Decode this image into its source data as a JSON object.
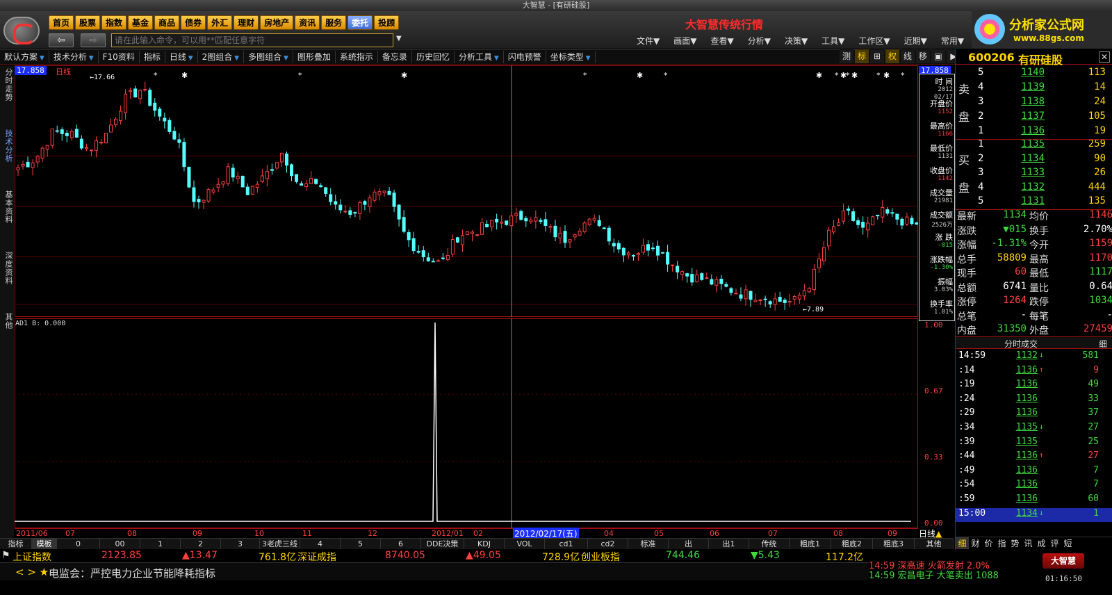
{
  "window": {
    "title": "大智慧 - [有研硅股]"
  },
  "nav_buttons": [
    "首页",
    "股票",
    "指数",
    "基金",
    "商品",
    "债券",
    "外汇",
    "理财",
    "房地产",
    "资讯",
    "服务",
    "委托",
    "投顾"
  ],
  "nav_active": 11,
  "command_input": {
    "placeholder": "请在此输入命令，可以用**匹配任意字符"
  },
  "headline": "大智慧传统行情",
  "top_menu": [
    "文件▼",
    "画面▼",
    "查看▼",
    "分析▼",
    "决策▼",
    "工具▼",
    "工作区▼",
    "近期▼",
    "常用▼"
  ],
  "brand": {
    "name": "分析家公式网",
    "url": "www.88gs.com"
  },
  "sub_toolbar": [
    {
      "label": "默认方案",
      "dd": true
    },
    {
      "label": "技术分析",
      "dd": true
    },
    {
      "label": "F10资料",
      "dd": false
    },
    {
      "label": "指标",
      "dd": false
    },
    {
      "label": "日线",
      "dd": true
    },
    {
      "label": "2图组合",
      "dd": true
    },
    {
      "label": "多图组合",
      "dd": true
    },
    {
      "label": "图形叠加",
      "dd": false
    },
    {
      "label": "系统指示",
      "dd": false
    },
    {
      "label": "备忘录",
      "dd": false
    },
    {
      "label": "历史回忆",
      "dd": false
    },
    {
      "label": "分析工具",
      "dd": true
    },
    {
      "label": "闪电预警",
      "dd": false
    },
    {
      "label": "坐标类型",
      "dd": true
    }
  ],
  "sub_tools": [
    "测",
    "标",
    "⊞",
    "权",
    "线",
    "移",
    "▣",
    "▶"
  ],
  "left_tabs": [
    "分时走势",
    "技术分析",
    "基本资料",
    "深度资料",
    "其他"
  ],
  "left_tab_active": 1,
  "chart": {
    "price_high_tag": "17.858",
    "period_label": "日线",
    "high_mark": "17.66",
    "low_mark": "7.89",
    "indicator_label": "AD1  B: 0.000",
    "indicator_axis": [
      "1.00",
      "0.67",
      "0.33",
      "0.00"
    ],
    "cursor_date": "2012/02/17(五)",
    "time_ticks": [
      "2011/06",
      "07",
      "08",
      "09",
      "10",
      "11",
      "12",
      "2012/01",
      "02",
      "03",
      "04",
      "05",
      "06",
      "07",
      "08",
      "09"
    ],
    "period_bottom": "日线",
    "colors": {
      "up": "#ff4040",
      "down": "#54ffff",
      "grid": "#5a0000"
    }
  },
  "chart_data": {
    "type": "candlestick",
    "ylim": [
      7.5,
      18.2
    ],
    "series_anchor_closes": [
      13.9,
      14.3,
      15.5,
      15.4,
      14.7,
      15.4,
      16.9,
      17.4,
      16.2,
      15.2,
      12.3,
      12.9,
      13.8,
      12.8,
      13.5,
      14.6,
      13.0,
      13.3,
      12.1,
      11.9,
      12.7,
      12.6,
      10.8,
      10.0,
      9.6,
      10.9,
      11.1,
      11.4,
      11.6,
      11.8,
      11.2,
      10.7,
      11.4,
      11.5,
      10.3,
      10.1,
      10.5,
      9.7,
      9.1,
      8.9,
      8.6,
      8.3,
      8.2,
      8.0,
      7.9,
      8.8,
      10.9,
      11.9,
      11.1,
      11.9,
      11.6,
      11.3
    ]
  },
  "info_box": [
    {
      "label": "时 间",
      "value": "2012",
      "value2": "02/17",
      "color": "w"
    },
    {
      "label": "开盘价",
      "value": "1152",
      "color": "r"
    },
    {
      "label": "最高价",
      "value": "1166",
      "color": "r"
    },
    {
      "label": "最低价",
      "value": "1131",
      "color": "w"
    },
    {
      "label": "收盘价",
      "value": "1142",
      "color": "r"
    },
    {
      "label": "成交量",
      "value": "21981",
      "color": "w"
    },
    {
      "label": "成交额",
      "value": "2526万",
      "color": "w"
    },
    {
      "label": "涨 跌",
      "value": "-015",
      "color": "g"
    },
    {
      "label": "涨跌幅",
      "value": "-1.30%",
      "color": "g"
    },
    {
      "label": "振幅",
      "value": "3.03%",
      "color": "w"
    },
    {
      "label": "换手率",
      "value": "1.01%",
      "color": "w"
    }
  ],
  "bottom_tabs": [
    "指标",
    "模板",
    "0",
    "00",
    "1",
    "2",
    "3",
    "3老虎三线",
    "4",
    "5",
    "6",
    "DDE决策",
    "KDJ",
    "VOL",
    "cd1",
    "cd2",
    "标准",
    "出",
    "出1",
    "传统",
    "粗底1",
    "粗底2",
    "粗底3",
    "其他"
  ],
  "bottom_tab_active": 1,
  "ticker": {
    "sh_name": "上证指数",
    "sh_value": "2123.85",
    "sh_change": "▲13.47",
    "sh_amount": "761.8亿",
    "sz_name": "深证成指",
    "sz_value": "8740.05",
    "sz_change": "▲49.05",
    "sz_amount": "728.9亿",
    "cy_name": "创业板指",
    "cy_value": "744.46",
    "cy_change": "▼5.43",
    "cy_amount": "117.2亿"
  },
  "news": {
    "nav": "< > ★",
    "text": "电监会：严控电力企业节能降耗指标"
  },
  "alerts": [
    "14:59 深高速  火箭发射 2.0%",
    "14:59 宏昌电子 大笔卖出 1088"
  ],
  "badge": "大智慧",
  "clock": "01:16:50",
  "stock": {
    "code": "600206",
    "name": "有研硅股"
  },
  "sell_label": [
    "卖",
    "盘"
  ],
  "buy_label": [
    "买",
    "盘"
  ],
  "sell_orders": [
    {
      "level": "5",
      "price": "1140",
      "volume": "113"
    },
    {
      "level": "4",
      "price": "1139",
      "volume": "14"
    },
    {
      "level": "3",
      "price": "1138",
      "volume": "24"
    },
    {
      "level": "2",
      "price": "1137",
      "volume": "105"
    },
    {
      "level": "1",
      "price": "1136",
      "volume": "19"
    }
  ],
  "buy_orders": [
    {
      "level": "1",
      "price": "1135",
      "volume": "259"
    },
    {
      "level": "2",
      "price": "1134",
      "volume": "90"
    },
    {
      "level": "3",
      "price": "1133",
      "volume": "26"
    },
    {
      "level": "4",
      "price": "1132",
      "volume": "444"
    },
    {
      "level": "5",
      "price": "1131",
      "volume": "135"
    }
  ],
  "quote": [
    {
      "l1": "最新",
      "v1": "1134",
      "c1": "grn",
      "l2": "均价",
      "v2": "1146",
      "c2": "red"
    },
    {
      "l1": "涨跌",
      "v1": "▼015",
      "c1": "grn",
      "l2": "换手",
      "v2": "2.70%",
      "c2": "wht"
    },
    {
      "l1": "涨幅",
      "v1": "-1.31%",
      "c1": "grn",
      "l2": "今开",
      "v2": "1159",
      "c2": "red"
    },
    {
      "l1": "总手",
      "v1": "58809",
      "c1": "yel",
      "l2": "最高",
      "v2": "1170",
      "c2": "red"
    },
    {
      "l1": "现手",
      "v1": "60",
      "c1": "red",
      "l2": "最低",
      "v2": "1117",
      "c2": "grn"
    },
    {
      "l1": "总额",
      "v1": "6741",
      "c1": "wht",
      "l2": "量比",
      "v2": "0.64",
      "c2": "wht"
    },
    {
      "l1": "涨停",
      "v1": "1264",
      "c1": "red",
      "l2": "跌停",
      "v2": "1034",
      "c2": "grn"
    },
    {
      "l1": "总笔",
      "v1": "-",
      "c1": "wht",
      "l2": "每笔",
      "v2": "-",
      "c2": "wht"
    },
    {
      "l1": "内盘",
      "v1": "31350",
      "c1": "grn",
      "l2": "外盘",
      "v2": "27459",
      "c2": "red"
    }
  ],
  "trades_header": {
    "title": "分时成交",
    "detail": "细"
  },
  "trades": [
    {
      "time": "14:59",
      "price": "1132",
      "dir": "dn",
      "vol": "581"
    },
    {
      "time": ":14",
      "price": "1136",
      "dir": "up",
      "vol": "9"
    },
    {
      "time": ":19",
      "price": "1136",
      "dir": "",
      "vol": "49"
    },
    {
      "time": ":24",
      "price": "1136",
      "dir": "",
      "vol": "33"
    },
    {
      "time": ":29",
      "price": "1136",
      "dir": "",
      "vol": "37"
    },
    {
      "time": ":34",
      "price": "1135",
      "dir": "dn",
      "vol": "27"
    },
    {
      "time": ":39",
      "price": "1135",
      "dir": "",
      "vol": "25"
    },
    {
      "time": ":44",
      "price": "1136",
      "dir": "up",
      "vol": "27"
    },
    {
      "time": ":49",
      "price": "1136",
      "dir": "",
      "vol": "7"
    },
    {
      "time": ":54",
      "price": "1136",
      "dir": "",
      "vol": "7"
    },
    {
      "time": ":59",
      "price": "1136",
      "dir": "",
      "vol": "60"
    },
    {
      "time": "15:00",
      "price": "1134",
      "dir": "dn",
      "vol": "1"
    }
  ],
  "right_tabs": [
    "细",
    "财",
    "价",
    "指",
    "势",
    "讯",
    "成",
    "评",
    "短"
  ],
  "right_tab_active": 0
}
